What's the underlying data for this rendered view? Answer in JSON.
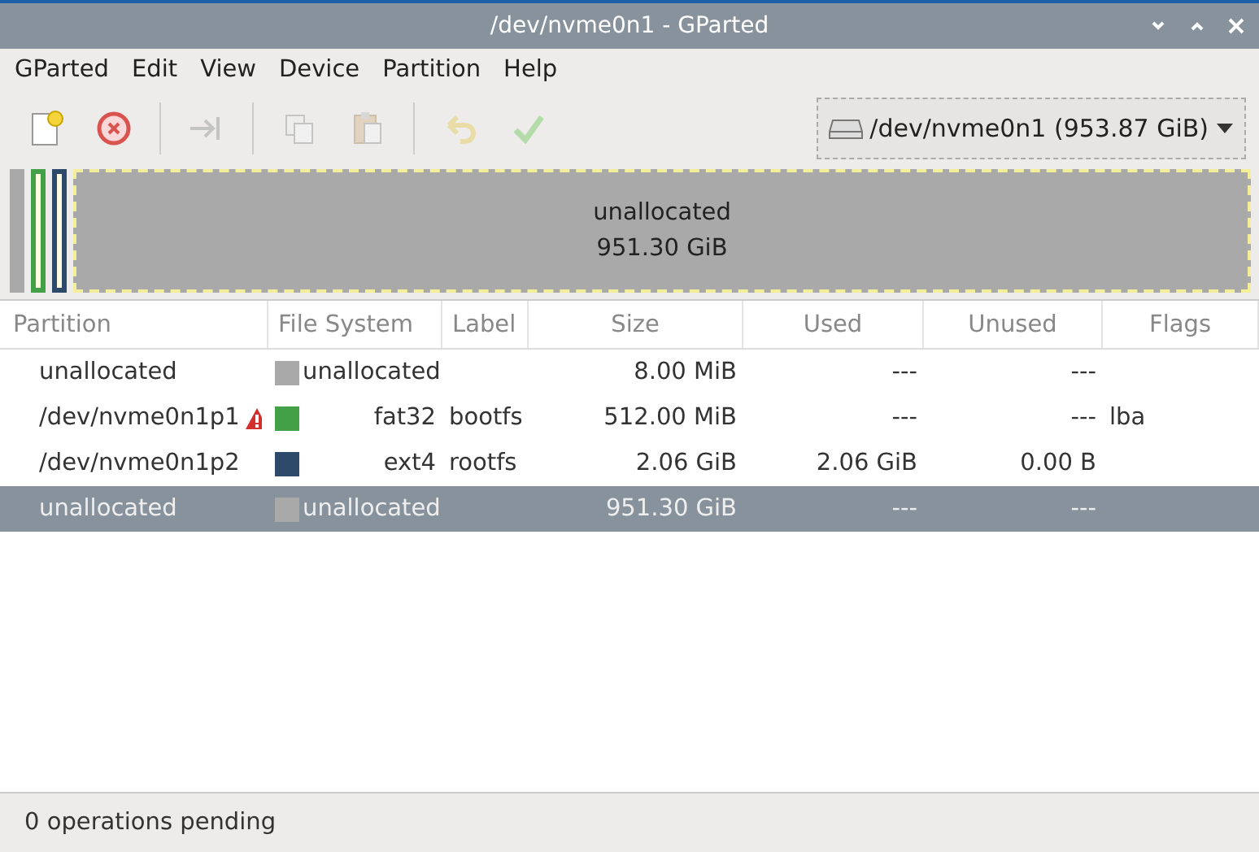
{
  "window": {
    "title": "/dev/nvme0n1 - GParted"
  },
  "menu": [
    "GParted",
    "Edit",
    "View",
    "Device",
    "Partition",
    "Help"
  ],
  "toolbar": [
    {
      "kind": "new",
      "disabled": false
    },
    {
      "kind": "delete",
      "disabled": false
    },
    {
      "kind": "resize",
      "disabled": true
    },
    {
      "kind": "copy",
      "disabled": true
    },
    {
      "kind": "paste",
      "disabled": true
    },
    {
      "kind": "undo",
      "disabled": true
    },
    {
      "kind": "apply",
      "disabled": true
    }
  ],
  "device_selector": {
    "value": "/dev/nvme0n1 (953.87 GiB)"
  },
  "disk_map": {
    "segments": [
      {
        "color": "#a9a9a9",
        "selected": false
      },
      {
        "color": "#43a047",
        "selected": false
      },
      {
        "color": "#2e4a6b",
        "selected": false
      },
      {
        "color": "#a9a9a9",
        "selected": true,
        "name": "unallocated",
        "size": "951.30 GiB"
      }
    ]
  },
  "table": {
    "columns": [
      "Partition",
      "File System",
      "Label",
      "Size",
      "Used",
      "Unused",
      "Flags"
    ],
    "rows": [
      {
        "partition": "unallocated",
        "warning": false,
        "color": "#a9a9a9",
        "file_system": "unallocated",
        "label": "",
        "size": "8.00 MiB",
        "used": "---",
        "unused": "---",
        "flags": "",
        "selected": false
      },
      {
        "partition": "/dev/nvme0n1p1",
        "warning": true,
        "color": "#43a047",
        "file_system": "fat32",
        "label": "bootfs",
        "size": "512.00 MiB",
        "used": "---",
        "unused": "---",
        "flags": "lba",
        "selected": false
      },
      {
        "partition": "/dev/nvme0n1p2",
        "warning": false,
        "color": "#2e4a6b",
        "file_system": "ext4",
        "label": "rootfs",
        "size": "2.06 GiB",
        "used": "2.06 GiB",
        "unused": "0.00 B",
        "flags": "",
        "selected": false
      },
      {
        "partition": "unallocated",
        "warning": false,
        "color": "#a9a9a9",
        "file_system": "unallocated",
        "label": "",
        "size": "951.30 GiB",
        "used": "---",
        "unused": "---",
        "flags": "",
        "selected": true
      }
    ]
  },
  "status_bar": "0 operations pending"
}
